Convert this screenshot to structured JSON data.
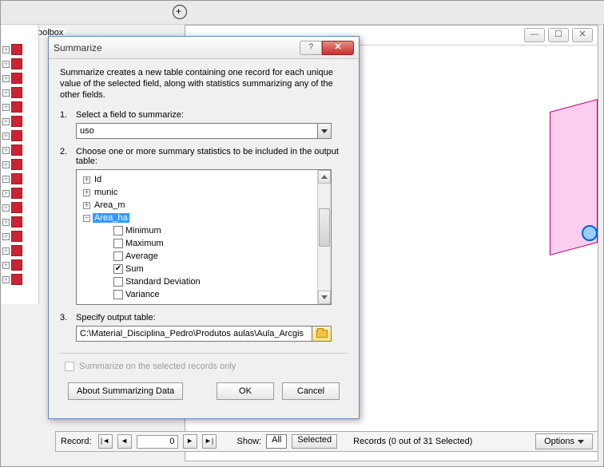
{
  "sidebar": {
    "toolbox_label": "ArcToolbox"
  },
  "content_window": {
    "min": "—",
    "max": "☐",
    "close": "✕"
  },
  "record_bar": {
    "label": "Record:",
    "first": "|◄",
    "prev": "◄",
    "value": "0",
    "next": "►",
    "last": "►|",
    "show_label": "Show:",
    "all": "All",
    "selected": "Selected",
    "records_text": "Records (0 out of 31 Selected)",
    "options": "Options"
  },
  "dialog": {
    "title": "Summarize",
    "help": "?",
    "close": "✕",
    "intro": "Summarize creates a new table containing one record for each unique value of the selected field, along with statistics summarizing any of the other fields.",
    "step1_num": "1.",
    "step1_text": "Select a field to summarize:",
    "field_value": "uso",
    "step2_num": "2.",
    "step2_text": "Choose one or more summary statistics to be included in the output table:",
    "tree": {
      "id": "Id",
      "munic": "munic",
      "area_m": "Area_m",
      "area_ha": "Area_ha",
      "stats": {
        "minimum": "Minimum",
        "maximum": "Maximum",
        "average": "Average",
        "sum": "Sum",
        "stddev": "Standard Deviation",
        "variance": "Variance"
      }
    },
    "step3_num": "3.",
    "step3_text": "Specify output table:",
    "output_path": "C:\\Material_Disciplina_Pedro\\Produtos aulas\\Aula_Arcgis",
    "summarize_selected_only": "Summarize on the selected records only",
    "about_btn": "About Summarizing Data",
    "ok": "OK",
    "cancel": "Cancel"
  }
}
